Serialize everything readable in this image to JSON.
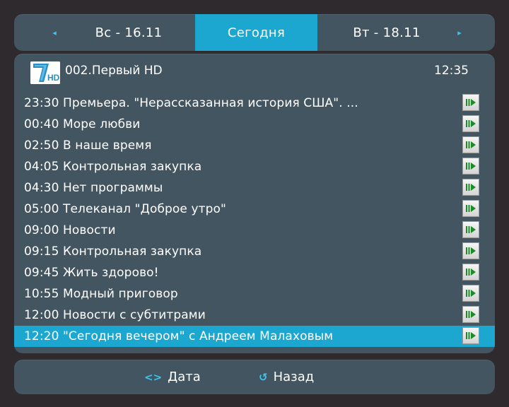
{
  "date_bar": {
    "prev_label": "Вс - 16.11",
    "current_label": "Сегодня",
    "next_label": "Вт - 18.11",
    "prev_arrow": "◂",
    "next_arrow": "▸"
  },
  "channel": {
    "logo_text": "HD",
    "name": "002.Первый HD",
    "clock": "12:35"
  },
  "programs": [
    {
      "text": "23:30 Премьера. \"Нерассказанная история США\". ..."
    },
    {
      "text": "00:40 Море любви"
    },
    {
      "text": "02:50 В наше время"
    },
    {
      "text": "04:05 Контрольная закупка"
    },
    {
      "text": "04:30 Нет программы"
    },
    {
      "text": "05:00 Телеканал \"Доброе утро\""
    },
    {
      "text": "09:00 Новости"
    },
    {
      "text": "09:15 Контрольная закупка"
    },
    {
      "text": "09:45 Жить здорово!"
    },
    {
      "text": "10:55 Модный приговор"
    },
    {
      "text": "12:00 Новости с субтитрами"
    },
    {
      "text": "12:20 \"Сегодня вечером\" с Андреем Малаховым"
    }
  ],
  "selected_index": 11,
  "footer": {
    "date_icon": "<>",
    "date_label": "Дата",
    "back_icon": "↺",
    "back_label": "Назад"
  },
  "colors": {
    "panel": "#435561",
    "accent": "#1ba7cf",
    "icon_accent": "#39c6ef",
    "record_arrow": "#1e8a2a",
    "background": "#2f2a2e"
  }
}
